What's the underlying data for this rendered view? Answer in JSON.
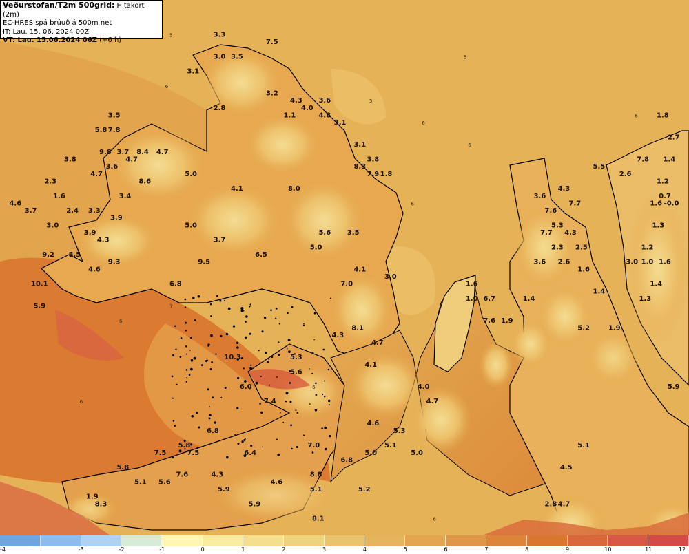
{
  "header": {
    "title_main": "Veðurstofan/T2m 500grid:",
    "title_sub": "Hitakort (2m)",
    "model": "EC-HRES spá brúuð á 500m net",
    "init_time": "IT: Lau. 15. 06. 2024 00Z",
    "valid_time_bold": "VT: Lau. 15.06.2024 06Z",
    "valid_time_offset": "(+6 h)"
  },
  "colors": {
    "sea_warm": "#d9772f",
    "sea": "#e3a64e",
    "coast_line": "#000000",
    "land_low": "#e8a24a",
    "land_mid": "#edbf66",
    "land_high": "#f3d98c",
    "warm_spot": "#d7563a"
  },
  "temperature_labels": [
    {
      "value": "3.3",
      "lon": -22.4,
      "lat": 66.45
    },
    {
      "value": "7.5",
      "lon": -22.16,
      "lat": 66.44
    },
    {
      "value": "3.0",
      "lon": -22.4,
      "lat": 66.42
    },
    {
      "value": "3.5",
      "lon": -22.32,
      "lat": 66.42
    },
    {
      "value": "3.1",
      "lon": -22.52,
      "lat": 66.4
    },
    {
      "value": "3.2",
      "lon": -22.16,
      "lat": 66.37
    },
    {
      "value": "4.3",
      "lon": -22.05,
      "lat": 66.36
    },
    {
      "value": "3.6",
      "lon": -21.92,
      "lat": 66.36
    },
    {
      "value": "2.8",
      "lon": -22.4,
      "lat": 66.35
    },
    {
      "value": "4.0",
      "lon": -22.0,
      "lat": 66.35
    },
    {
      "value": "4.8",
      "lon": -21.92,
      "lat": 66.34
    },
    {
      "value": "1.1",
      "lon": -22.08,
      "lat": 66.34
    },
    {
      "value": "3.5",
      "lon": -22.88,
      "lat": 66.34
    },
    {
      "value": "3.1",
      "lon": -21.85,
      "lat": 66.33
    },
    {
      "value": "5.8",
      "lon": -22.94,
      "lat": 66.32
    },
    {
      "value": "7.8",
      "lon": -22.88,
      "lat": 66.32
    },
    {
      "value": "3.1",
      "lon": -21.76,
      "lat": 66.3
    },
    {
      "value": "9.8",
      "lon": -22.92,
      "lat": 66.29
    },
    {
      "value": "3.7",
      "lon": -22.84,
      "lat": 66.29
    },
    {
      "value": "8.4",
      "lon": -22.75,
      "lat": 66.29
    },
    {
      "value": "4.7",
      "lon": -22.66,
      "lat": 66.29
    },
    {
      "value": "3.8",
      "lon": -21.7,
      "lat": 66.28
    },
    {
      "value": "3.8",
      "lon": -23.08,
      "lat": 66.28
    },
    {
      "value": "4.7",
      "lon": -22.8,
      "lat": 66.28
    },
    {
      "value": "3.6",
      "lon": -22.89,
      "lat": 66.27
    },
    {
      "value": "8.3",
      "lon": -21.76,
      "lat": 66.27
    },
    {
      "value": "7.9",
      "lon": -21.7,
      "lat": 66.26
    },
    {
      "value": "1.8",
      "lon": -21.64,
      "lat": 66.26
    },
    {
      "value": "4.7",
      "lon": -22.96,
      "lat": 66.26
    },
    {
      "value": "2.3",
      "lon": -23.17,
      "lat": 66.25
    },
    {
      "value": "8.6",
      "lon": -22.74,
      "lat": 66.25
    },
    {
      "value": "5.0",
      "lon": -22.53,
      "lat": 66.26
    },
    {
      "value": "4.1",
      "lon": -22.32,
      "lat": 66.24
    },
    {
      "value": "8.0",
      "lon": -22.06,
      "lat": 66.24
    },
    {
      "value": "1.6",
      "lon": -23.13,
      "lat": 66.23
    },
    {
      "value": "3.4",
      "lon": -22.83,
      "lat": 66.23
    },
    {
      "value": "4.6",
      "lon": -23.33,
      "lat": 66.22
    },
    {
      "value": "2.4",
      "lon": -23.07,
      "lat": 66.21
    },
    {
      "value": "3.3",
      "lon": -22.97,
      "lat": 66.21
    },
    {
      "value": "3.7",
      "lon": -23.26,
      "lat": 66.21
    },
    {
      "value": "3.9",
      "lon": -22.87,
      "lat": 66.2
    },
    {
      "value": "3.0",
      "lon": -23.16,
      "lat": 66.19
    },
    {
      "value": "5.0",
      "lon": -22.53,
      "lat": 66.19
    },
    {
      "value": "5.6",
      "lon": -21.92,
      "lat": 66.18
    },
    {
      "value": "3.5",
      "lon": -21.79,
      "lat": 66.18
    },
    {
      "value": "3.9",
      "lon": -22.99,
      "lat": 66.18
    },
    {
      "value": "4.3",
      "lon": -22.93,
      "lat": 66.17
    },
    {
      "value": "3.7",
      "lon": -22.4,
      "lat": 66.17
    },
    {
      "value": "6.5",
      "lon": -22.21,
      "lat": 66.15
    },
    {
      "value": "5.0",
      "lon": -21.96,
      "lat": 66.16
    },
    {
      "value": "9.2",
      "lon": -23.18,
      "lat": 66.15
    },
    {
      "value": "8.5",
      "lon": -23.06,
      "lat": 66.15
    },
    {
      "value": "9.3",
      "lon": -22.88,
      "lat": 66.14
    },
    {
      "value": "9.5",
      "lon": -22.47,
      "lat": 66.14
    },
    {
      "value": "4.6",
      "lon": -22.97,
      "lat": 66.13
    },
    {
      "value": "4.1",
      "lon": -21.76,
      "lat": 66.13
    },
    {
      "value": "3.0",
      "lon": -21.62,
      "lat": 66.12
    },
    {
      "value": "10.1",
      "lon": -23.22,
      "lat": 66.11
    },
    {
      "value": "6.8",
      "lon": -22.6,
      "lat": 66.11
    },
    {
      "value": "7.0",
      "lon": -21.82,
      "lat": 66.11
    },
    {
      "value": "5.9",
      "lon": -23.22,
      "lat": 66.08
    },
    {
      "value": "8.1",
      "lon": -21.77,
      "lat": 66.05
    },
    {
      "value": "4.3",
      "lon": -21.86,
      "lat": 66.04
    },
    {
      "value": "4.7",
      "lon": -21.68,
      "lat": 66.03
    },
    {
      "value": "10.3",
      "lon": -22.34,
      "lat": 66.01
    },
    {
      "value": "5.3",
      "lon": -22.05,
      "lat": 66.01
    },
    {
      "value": "4.1",
      "lon": -21.71,
      "lat": 66.0
    },
    {
      "value": "5.6",
      "lon": -22.05,
      "lat": 65.99
    },
    {
      "value": "6.0",
      "lon": -22.28,
      "lat": 65.97
    },
    {
      "value": "4.0",
      "lon": -21.47,
      "lat": 65.97
    },
    {
      "value": "7.4",
      "lon": -22.17,
      "lat": 65.95
    },
    {
      "value": "4.7",
      "lon": -21.43,
      "lat": 65.95
    },
    {
      "value": "4.6",
      "lon": -21.7,
      "lat": 65.92
    },
    {
      "value": "5.3",
      "lon": -21.58,
      "lat": 65.91
    },
    {
      "value": "6.8",
      "lon": -22.43,
      "lat": 65.91
    },
    {
      "value": "5.1",
      "lon": -21.62,
      "lat": 65.89
    },
    {
      "value": "5.8",
      "lon": -22.56,
      "lat": 65.89
    },
    {
      "value": "6.4",
      "lon": -22.26,
      "lat": 65.88
    },
    {
      "value": "7.0",
      "lon": -21.97,
      "lat": 65.89
    },
    {
      "value": "5.0",
      "lon": -21.71,
      "lat": 65.88
    },
    {
      "value": "5.0",
      "lon": -21.5,
      "lat": 65.88
    },
    {
      "value": "7.5",
      "lon": -22.67,
      "lat": 65.88
    },
    {
      "value": "7.5",
      "lon": -22.52,
      "lat": 65.88
    },
    {
      "value": "6.8",
      "lon": -21.82,
      "lat": 65.87
    },
    {
      "value": "5.8",
      "lon": -22.84,
      "lat": 65.86
    },
    {
      "value": "8.8",
      "lon": -21.96,
      "lat": 65.85
    },
    {
      "value": "7.6",
      "lon": -22.57,
      "lat": 65.85
    },
    {
      "value": "4.3",
      "lon": -22.41,
      "lat": 65.85
    },
    {
      "value": "4.6",
      "lon": -22.14,
      "lat": 65.84
    },
    {
      "value": "5.1",
      "lon": -22.76,
      "lat": 65.84
    },
    {
      "value": "5.6",
      "lon": -22.65,
      "lat": 65.84
    },
    {
      "value": "5.1",
      "lon": -21.96,
      "lat": 65.83
    },
    {
      "value": "5.2",
      "lon": -21.74,
      "lat": 65.83
    },
    {
      "value": "5.9",
      "lon": -22.38,
      "lat": 65.83
    },
    {
      "value": "1.9",
      "lon": -22.98,
      "lat": 65.82
    },
    {
      "value": "5.9",
      "lon": -22.24,
      "lat": 65.81
    },
    {
      "value": "8.3",
      "lon": -22.94,
      "lat": 65.81
    },
    {
      "value": "8.1",
      "lon": -21.95,
      "lat": 65.79
    },
    {
      "value": "1.6",
      "lon": -21.25,
      "lat": 66.11
    },
    {
      "value": "1.0",
      "lon": -21.25,
      "lat": 66.09
    },
    {
      "value": "6.7",
      "lon": -21.17,
      "lat": 66.09
    },
    {
      "value": "7.6",
      "lon": -21.17,
      "lat": 66.06
    },
    {
      "value": "1.9",
      "lon": -21.09,
      "lat": 66.06
    },
    {
      "value": "1.4",
      "lon": -20.99,
      "lat": 66.09
    },
    {
      "value": "3.6",
      "lon": -20.94,
      "lat": 66.23
    },
    {
      "value": "4.3",
      "lon": -20.83,
      "lat": 66.24
    },
    {
      "value": "7.6",
      "lon": -20.89,
      "lat": 66.21
    },
    {
      "value": "7.7",
      "lon": -20.78,
      "lat": 66.22
    },
    {
      "value": "5.3",
      "lon": -20.86,
      "lat": 66.19
    },
    {
      "value": "7.7",
      "lon": -20.91,
      "lat": 66.18
    },
    {
      "value": "4.3",
      "lon": -20.8,
      "lat": 66.18
    },
    {
      "value": "2.3",
      "lon": -20.86,
      "lat": 66.16
    },
    {
      "value": "2.5",
      "lon": -20.75,
      "lat": 66.16
    },
    {
      "value": "3.6",
      "lon": -20.94,
      "lat": 66.14
    },
    {
      "value": "2.6",
      "lon": -20.83,
      "lat": 66.14
    },
    {
      "value": "1.6",
      "lon": -20.74,
      "lat": 66.13
    },
    {
      "value": "1.4",
      "lon": -20.67,
      "lat": 66.1
    },
    {
      "value": "5.2",
      "lon": -20.74,
      "lat": 66.05
    },
    {
      "value": "1.9",
      "lon": -20.6,
      "lat": 66.05
    },
    {
      "value": "5.1",
      "lon": -20.74,
      "lat": 65.89
    },
    {
      "value": "4.5",
      "lon": -20.82,
      "lat": 65.86
    },
    {
      "value": "2.8",
      "lon": -20.89,
      "lat": 65.81
    },
    {
      "value": "4.7",
      "lon": -20.83,
      "lat": 65.81
    },
    {
      "value": "5.5",
      "lon": -20.67,
      "lat": 66.27
    },
    {
      "value": "1.8",
      "lon": -20.38,
      "lat": 66.34
    },
    {
      "value": "2.7",
      "lon": -20.33,
      "lat": 66.31
    },
    {
      "value": "7.8",
      "lon": -20.47,
      "lat": 66.28
    },
    {
      "value": "1.4",
      "lon": -20.35,
      "lat": 66.28
    },
    {
      "value": "2.6",
      "lon": -20.55,
      "lat": 66.26
    },
    {
      "value": "1.2",
      "lon": -20.38,
      "lat": 66.25
    },
    {
      "value": "0.7",
      "lon": -20.37,
      "lat": 66.23
    },
    {
      "value": "1.6",
      "lon": -20.41,
      "lat": 66.22
    },
    {
      "value": "-0.0",
      "lon": -20.34,
      "lat": 66.22
    },
    {
      "value": "1.3",
      "lon": -20.4,
      "lat": 66.19
    },
    {
      "value": "1.2",
      "lon": -20.45,
      "lat": 66.16
    },
    {
      "value": "3.0",
      "lon": -20.52,
      "lat": 66.14
    },
    {
      "value": "1.0",
      "lon": -20.45,
      "lat": 66.14
    },
    {
      "value": "1.6",
      "lon": -20.37,
      "lat": 66.14
    },
    {
      "value": "1.4",
      "lon": -20.41,
      "lat": 66.11
    },
    {
      "value": "1.3",
      "lon": -20.46,
      "lat": 66.09
    },
    {
      "value": "5.9",
      "lon": -20.33,
      "lat": 65.97
    }
  ],
  "contour_labels": [
    {
      "value": "5",
      "lon": -22.75,
      "lat": 66.48
    },
    {
      "value": "6",
      "lon": -22.64,
      "lat": 66.38
    },
    {
      "value": "5",
      "lon": -22.62,
      "lat": 66.45
    },
    {
      "value": "5",
      "lon": -21.28,
      "lat": 66.42
    },
    {
      "value": "5",
      "lon": -21.71,
      "lat": 66.36
    },
    {
      "value": "6",
      "lon": -21.47,
      "lat": 66.33
    },
    {
      "value": "6",
      "lon": -21.26,
      "lat": 66.3
    },
    {
      "value": "6",
      "lon": -20.5,
      "lat": 66.34
    },
    {
      "value": "6",
      "lon": -22.85,
      "lat": 66.06
    },
    {
      "value": "6",
      "lon": -23.03,
      "lat": 65.95
    },
    {
      "value": "7",
      "lon": -22.62,
      "lat": 66.08
    },
    {
      "value": "6",
      "lon": -21.97,
      "lat": 65.97
    },
    {
      "value": "6",
      "lon": -21.52,
      "lat": 66.22
    },
    {
      "value": "6",
      "lon": -21.42,
      "lat": 65.79
    }
  ],
  "legend": {
    "ticks": [
      "-4",
      "-3",
      "-2",
      "-1",
      "0",
      "1",
      "2",
      "3",
      "4",
      "5",
      "6",
      "7",
      "8",
      "9",
      "10",
      "11",
      "12"
    ],
    "colors": [
      "#6fa6e0",
      "#8dbcec",
      "#aed2f4",
      "#d6ecd8",
      "#fff6b4",
      "#f9eba0",
      "#f3df8e",
      "#eed27c",
      "#e9c46c",
      "#e5b45c",
      "#e2a650",
      "#df9646",
      "#dc843a",
      "#d9772f",
      "#d8683a",
      "#d65845",
      "#d44a48"
    ]
  }
}
